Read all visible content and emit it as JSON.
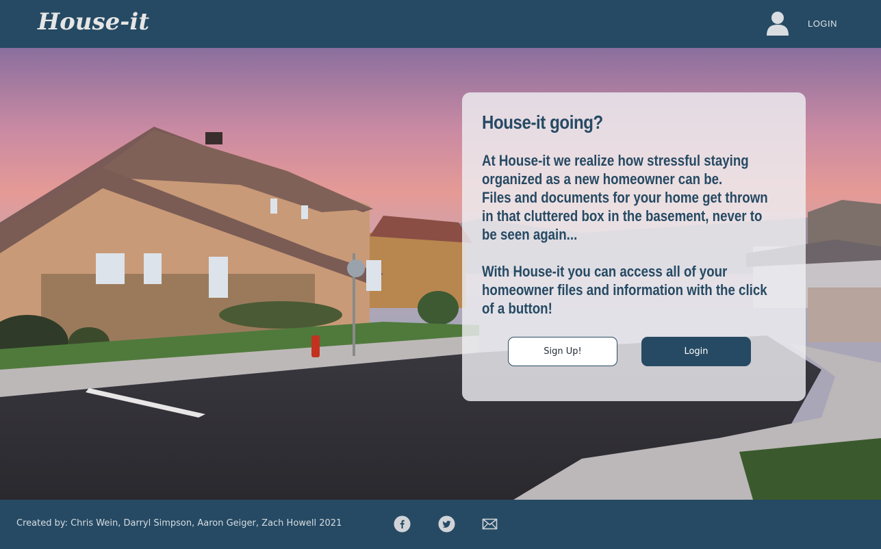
{
  "header": {
    "logo": "House-it",
    "login_label": "LOGIN",
    "user_icon": "user-icon"
  },
  "hero": {
    "background": "suburban-house-street-sunset-photo",
    "card": {
      "title": "House-it going?",
      "paragraphs": [
        "At House-it we realize how stressful staying organized as a new homeowner can be.",
        "Files and documents for your home get thrown in that cluttered box in the basement, never to be seen again...",
        "With House-it you can access all of your homeowner files and information with the click of a button!"
      ],
      "signup_label": "Sign Up!",
      "login_label": "Login"
    }
  },
  "footer": {
    "credits": "Created by: Chris Wein, Darryl Simpson, Aaron Geiger, Zach Howell 2021",
    "social_icons": [
      "facebook-icon",
      "twitter-icon",
      "mail-icon"
    ]
  },
  "colors": {
    "primary": "#264a63",
    "card_bg": "#eeeef2",
    "button_text_light": "#ffffff"
  }
}
